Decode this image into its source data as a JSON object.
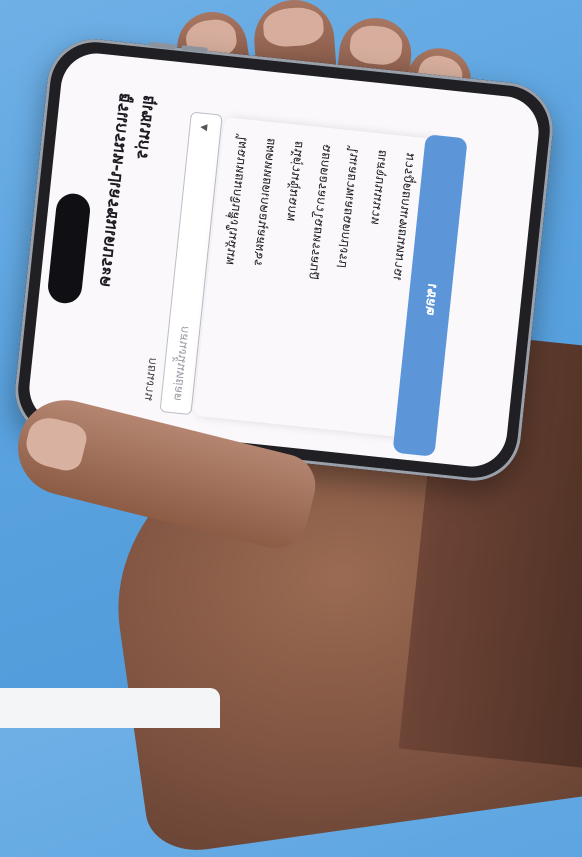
{
  "screen": {
    "title_line1": "ฮูรแกรมห-ปเลรชมเดบระค",
    "title_line2": "ยุเซเนก่ร",
    "label": "กยนงาน",
    "dropdown_value": "กสนงนั้นทย่ลต",
    "menu_items": [
      "ไผฉบหยมกจิบสื่งในฉันพ",
      "ยผคหหยดเกคอนุลสผ๖ร",
      "ยน้ตุ่วนขุ้มฉกพ",
      "ฉยกตอรลกวโฉยหรรลบฏ",
      "ไนเลยวพเลยฉตกปงรป",
      "ยเสจุบนนนวห",
      "มวรฎุดยกนเฑยนทมาฉเ",
      "ตุก"
    ],
    "action_button": "เชล๒",
    "accent_color": "#5c95d8"
  }
}
